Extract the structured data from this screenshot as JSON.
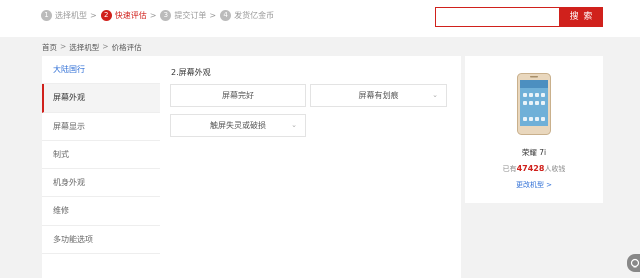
{
  "steps": [
    {
      "num": "1",
      "label": "选择机型",
      "sep": ">"
    },
    {
      "num": "2",
      "label": "快速评估",
      "sep": ">"
    },
    {
      "num": "3",
      "label": "提交订单",
      "sep": ">"
    },
    {
      "num": "4",
      "label": "发货亿金币",
      "sep": ""
    }
  ],
  "search": {
    "placeholder": "",
    "button_label": "搜 索"
  },
  "breadcrumb": [
    "首页",
    "选择机型",
    "价格评估"
  ],
  "sidebar": {
    "items": [
      "大陆国行",
      "屏幕外观",
      "屏幕显示",
      "制式",
      "机身外观",
      "维修",
      "多功能选项"
    ]
  },
  "main": {
    "section_title": "2.屏幕外观",
    "options": [
      "屏幕完好",
      "屏幕有划痕",
      "触屏失灵或破损"
    ]
  },
  "product": {
    "name": "荣耀 7i",
    "collected_prefix": "已有",
    "collected_count": "47428",
    "collected_suffix": "人收钱",
    "change_link": "更改机型 >"
  },
  "colors": {
    "accent": "#d0211c",
    "link": "#2f6fd6"
  },
  "icons": {
    "chevron": "chevron-down-icon",
    "chat": "chat-icon"
  }
}
